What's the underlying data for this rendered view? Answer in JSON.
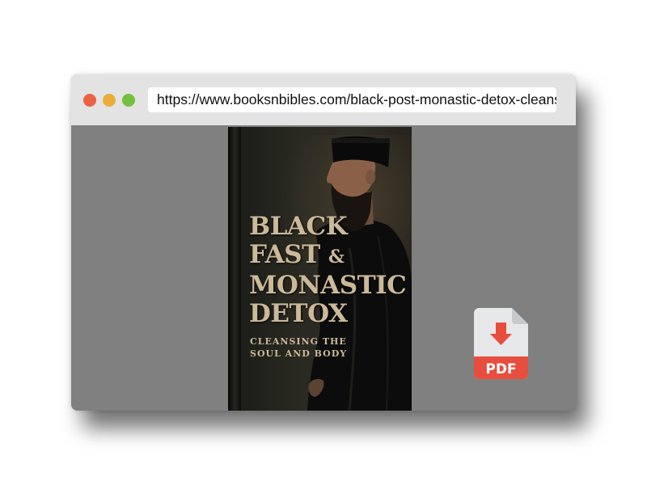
{
  "browser": {
    "url": "https://www.booksnbibles.com/black-post-monastic-detox-cleansing-the-soul-and-body"
  },
  "book_cover": {
    "title_lines": [
      "BLACK",
      "FAST",
      "&",
      "MONASTIC",
      "DETOX"
    ],
    "subtitle_lines": [
      "CLEANSING THE",
      "SOUL AND BODY"
    ]
  },
  "download": {
    "label": "PDF"
  },
  "colors": {
    "close": "#ec6343",
    "minimize": "#e9ad37",
    "maximize": "#74c040",
    "pdf_badge": "#e84e3d",
    "cover_text": "#cbb999"
  },
  "icons": [
    "close-dot-icon",
    "minimize-dot-icon",
    "maximize-dot-icon",
    "pdf-download-icon"
  ]
}
